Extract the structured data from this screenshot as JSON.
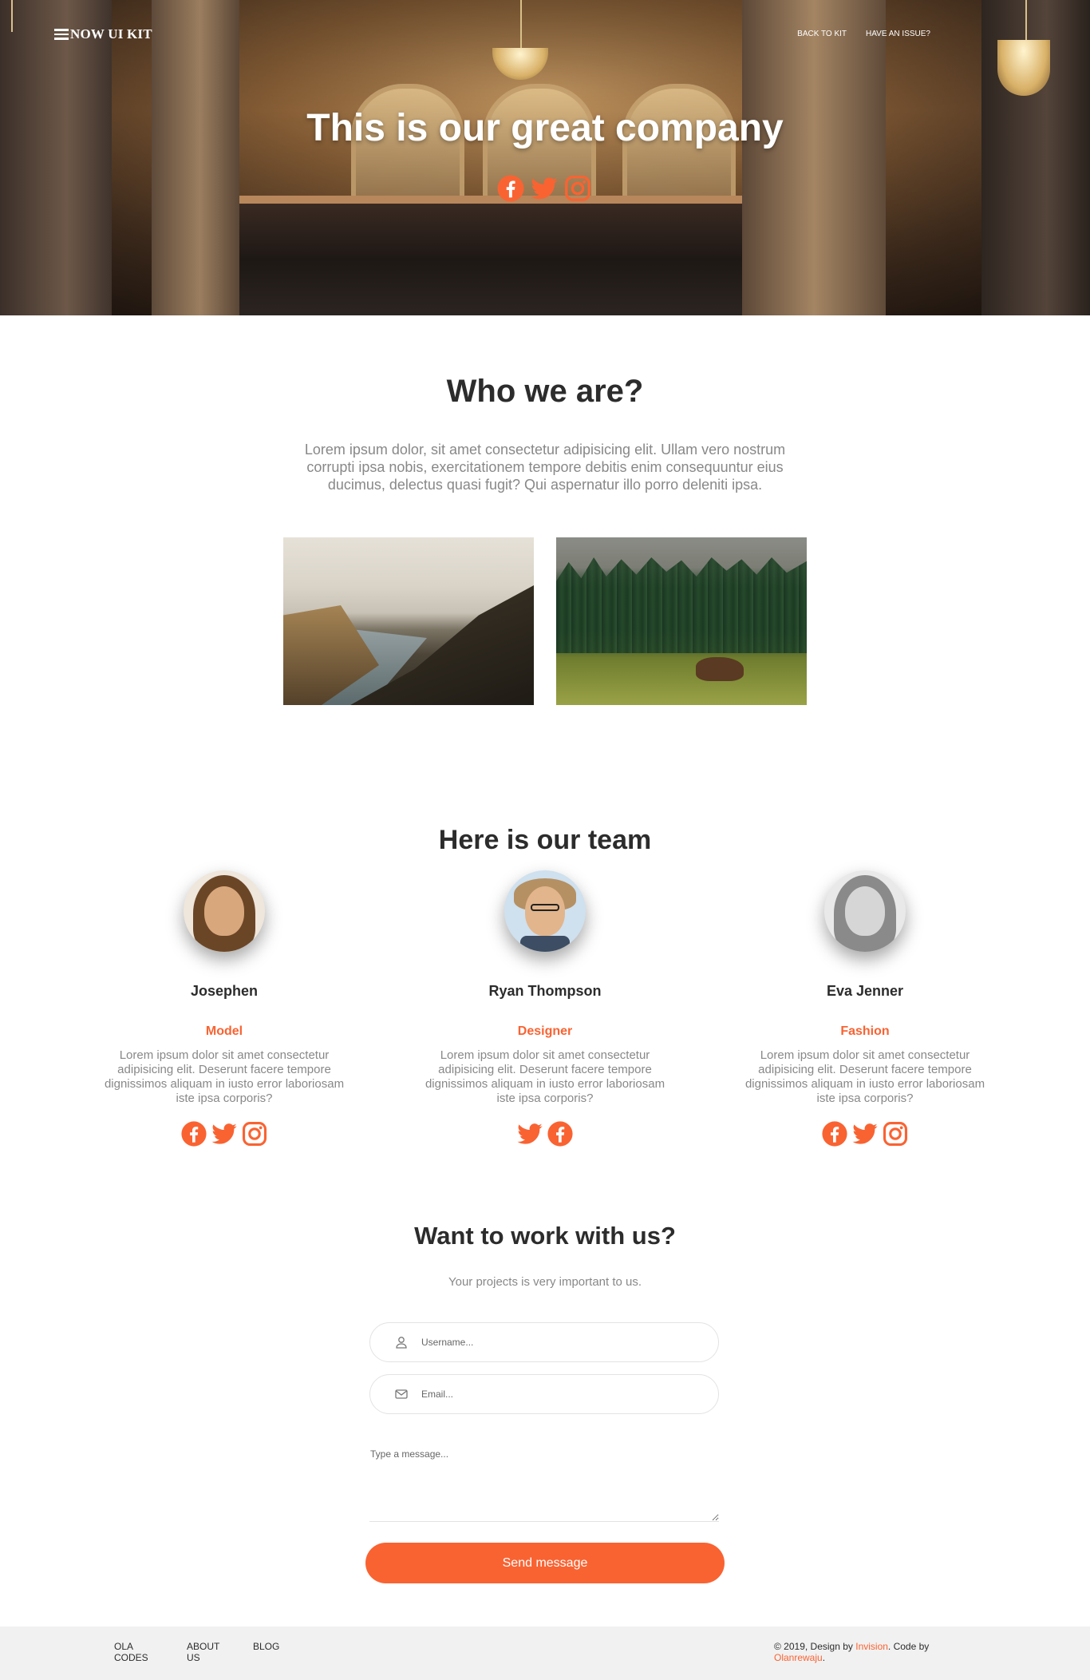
{
  "navbar": {
    "brand": "NOW UI KIT",
    "links": [
      "BACK TO KIT",
      "HAVE AN ISSUE?"
    ]
  },
  "hero": {
    "title": "This is our great company",
    "social": [
      "facebook-icon",
      "twitter-icon",
      "instagram-icon"
    ]
  },
  "about": {
    "title": "Who we are?",
    "text": "Lorem ipsum dolor, sit amet consectetur adipisicing elit. Ullam vero nostrum corrupti ipsa nobis, exercitationem tempore debitis enim consequuntur eius ducimus, delectus quasi fugit? Qui aspernatur illo porro deleniti ipsa."
  },
  "team": {
    "title": "Here is our team",
    "members": [
      {
        "name": "Josephen",
        "role": "Model",
        "description": "Lorem ipsum dolor sit amet consectetur adipisicing elit. Deserunt facere tempore dignissimos aliquam in iusto error laboriosam iste ipsa corporis?",
        "social": [
          "facebook-icon",
          "twitter-icon",
          "instagram-icon"
        ]
      },
      {
        "name": "Ryan Thompson",
        "role": "Designer",
        "description": "Lorem ipsum dolor sit amet consectetur adipisicing elit. Deserunt facere tempore dignissimos aliquam in iusto error laboriosam iste ipsa corporis?",
        "social": [
          "twitter-icon",
          "facebook-icon"
        ]
      },
      {
        "name": "Eva Jenner",
        "role": "Fashion",
        "description": "Lorem ipsum dolor sit amet consectetur adipisicing elit. Deserunt facere tempore dignissimos aliquam in iusto error laboriosam iste ipsa corporis?",
        "social": [
          "facebook-icon",
          "twitter-icon",
          "instagram-icon"
        ]
      }
    ]
  },
  "contact": {
    "title": "Want to work with us?",
    "subtitle": "Your projects is very important to us.",
    "username_placeholder": "Username...",
    "email_placeholder": "Email...",
    "message_placeholder": "Type a message...",
    "send_label": "Send message"
  },
  "footer": {
    "links": [
      "OLA CODES",
      "ABOUT US",
      "BLOG"
    ],
    "copyright_prefix": "© 2019, Design by ",
    "design_by": "Invision",
    "code_by_text": ". Code by ",
    "code_by": "Olanrewaju",
    "suffix": "."
  },
  "colors": {
    "accent": "#f96332",
    "text_dark": "#2c2c2c",
    "text_muted": "#888888",
    "footer_bg": "#f1f1f1"
  }
}
